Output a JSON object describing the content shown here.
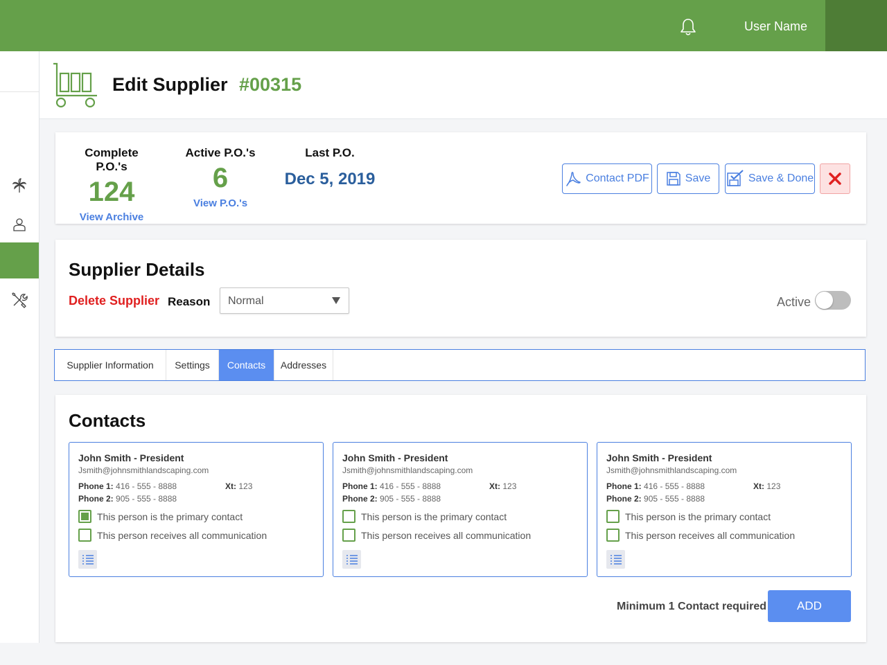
{
  "topbar": {
    "username": "User Name",
    "icons": [
      "bell-icon"
    ],
    "brand_color": "#65a04a"
  },
  "sidebar": {
    "items": [
      {
        "icon": "tree-icon"
      },
      {
        "icon": "person-icon"
      },
      {
        "icon": "active-item"
      },
      {
        "icon": "tools-icon"
      }
    ]
  },
  "header": {
    "title": "Edit Supplier",
    "number": "#00315",
    "icon": "cart-icon"
  },
  "stats": {
    "complete": {
      "label": "Complete P.O.'s",
      "value": "124",
      "link": "View Archive"
    },
    "active": {
      "label": "Active P.O.'s",
      "value": "6",
      "link": "View P.O.'s"
    },
    "last": {
      "label": "Last P.O.",
      "value": "Dec 5, 2019"
    }
  },
  "actions": {
    "contact_pdf": "Contact PDF",
    "save": "Save",
    "save_done": "Save & Done"
  },
  "details": {
    "title": "Supplier Details",
    "delete": "Delete Supplier",
    "reason_label": "Reason",
    "reason_value": "Normal",
    "active_label": "Active",
    "active": false
  },
  "tabs": [
    {
      "label": "Supplier Information"
    },
    {
      "label": "Settings"
    },
    {
      "label": "Contacts"
    },
    {
      "label": "Addresses"
    }
  ],
  "contacts": {
    "title": "Contacts",
    "min_required": "Minimum 1 Contact required",
    "add_label": "ADD",
    "items": [
      {
        "name": "John Smith - President",
        "email": "Jsmith@johnsmithlandscaping.com",
        "phone1_label": "Phone 1:",
        "phone1": "416 - 555 - 8888",
        "phone2_label": "Phone 2:",
        "phone2": "905 - 555 - 8888",
        "xt_label": "Xt:",
        "xt": "123",
        "primary_label": "This person is the primary contact",
        "primary": true,
        "comm_label": "This person receives all communication",
        "comm": false
      },
      {
        "name": "John Smith - President",
        "email": "Jsmith@johnsmithlandscaping.com",
        "phone1_label": "Phone 1:",
        "phone1": "416 - 555 - 8888",
        "phone2_label": "Phone 2:",
        "phone2": "905 - 555 - 8888",
        "xt_label": "Xt:",
        "xt": "123",
        "primary_label": "This person is the primary contact",
        "primary": false,
        "comm_label": "This person receives all communication",
        "comm": false
      },
      {
        "name": "John Smith - President",
        "email": "Jsmith@johnsmithlandscaping.com",
        "phone1_label": "Phone 1:",
        "phone1": "416 - 555 - 8888",
        "phone2_label": "Phone 2:",
        "phone2": "905 - 555 - 8888",
        "xt_label": "Xt:",
        "xt": "123",
        "primary_label": "This person is the primary contact",
        "primary": false,
        "comm_label": "This person receives all communication",
        "comm": false
      }
    ]
  }
}
